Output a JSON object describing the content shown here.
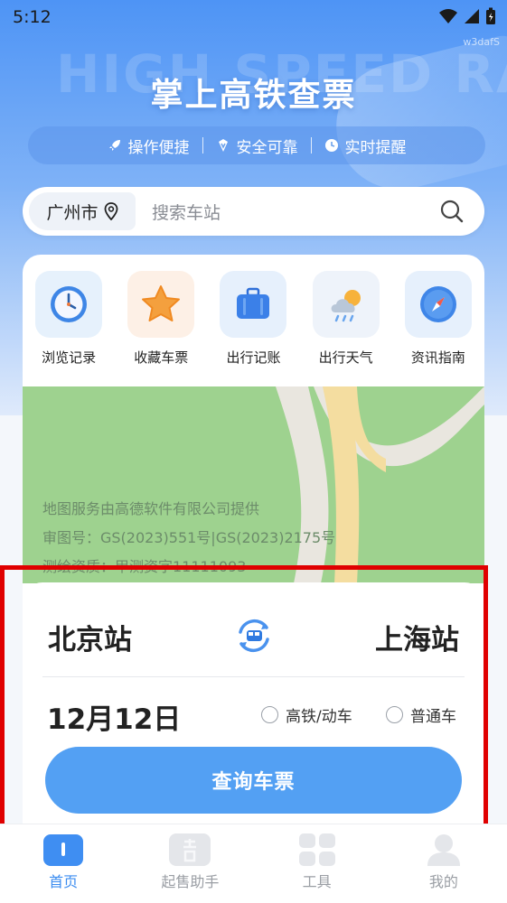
{
  "status_bar": {
    "time": "5:12",
    "corner_tag": "w3dafS"
  },
  "hero": {
    "watermark": "HIGH SPEED RAIL",
    "title": "掌上高铁查票"
  },
  "features": [
    {
      "icon": "rocket-icon",
      "label": "操作便捷"
    },
    {
      "icon": "shield-icon",
      "label": "安全可靠"
    },
    {
      "icon": "clock-icon",
      "label": "实时提醒"
    }
  ],
  "search": {
    "city": "广州市",
    "placeholder": "搜索车站"
  },
  "quick_grid": [
    {
      "icon": "clock-icon",
      "label": "浏览记录"
    },
    {
      "icon": "star-icon",
      "label": "收藏车票"
    },
    {
      "icon": "suitcase-icon",
      "label": "出行记账"
    },
    {
      "icon": "weather-icon",
      "label": "出行天气"
    },
    {
      "icon": "compass-icon",
      "label": "资讯指南"
    }
  ],
  "map": {
    "line1": "地图服务由高德软件有限公司提供",
    "line2": "审图号：GS(2023)551号|GS(2023)2175号",
    "line3": "测绘资质：甲测资字11111093"
  },
  "ticket": {
    "from": "北京站",
    "to": "上海站",
    "date": "12月12日",
    "option_highspeed": "高铁/动车",
    "option_regular": "普通车",
    "query_button": "查询车票"
  },
  "tabbar": [
    {
      "icon": "home-icon",
      "label": "首页",
      "active": true
    },
    {
      "icon": "ticket-sale-icon",
      "label": "起售助手",
      "active": false
    },
    {
      "icon": "tools-icon",
      "label": "工具",
      "active": false
    },
    {
      "icon": "user-icon",
      "label": "我的",
      "active": false
    }
  ],
  "colors": {
    "accent": "#53a0f3",
    "active_tab": "#3b8cf0",
    "highlight": "#e00000",
    "map_green": "#9ed28f"
  }
}
